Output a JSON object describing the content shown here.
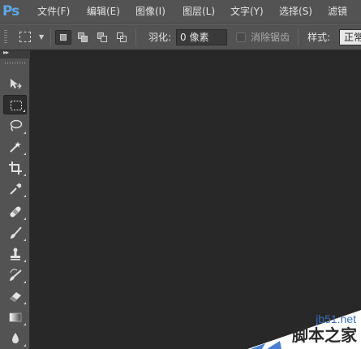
{
  "app": {
    "logo_text": "Ps"
  },
  "menu": [
    {
      "label": "文件(F)",
      "name": "menu-file"
    },
    {
      "label": "编辑(E)",
      "name": "menu-edit"
    },
    {
      "label": "图像(I)",
      "name": "menu-image"
    },
    {
      "label": "图层(L)",
      "name": "menu-layer"
    },
    {
      "label": "文字(Y)",
      "name": "menu-type"
    },
    {
      "label": "选择(S)",
      "name": "menu-select"
    },
    {
      "label": "滤镜",
      "name": "menu-filter"
    }
  ],
  "options": {
    "feather_label": "羽化:",
    "feather_value": "0 像素",
    "antialias_label": "消除锯齿",
    "antialias_checked": false,
    "style_label": "样式:",
    "style_value": "正常"
  },
  "tools": [
    {
      "name": "move-tool",
      "icon": "move-icon"
    },
    {
      "name": "rectangular-marquee-tool",
      "icon": "marquee-icon",
      "active": true
    },
    {
      "name": "lasso-tool",
      "icon": "lasso-icon"
    },
    {
      "name": "magic-wand-tool",
      "icon": "magic-wand-icon"
    },
    {
      "name": "crop-tool",
      "icon": "crop-icon"
    },
    {
      "name": "eyedropper-tool",
      "icon": "eyedropper-icon"
    },
    {
      "name": "healing-brush-tool",
      "icon": "bandage-icon"
    },
    {
      "name": "brush-tool",
      "icon": "brush-icon"
    },
    {
      "name": "clone-stamp-tool",
      "icon": "stamp-icon"
    },
    {
      "name": "history-brush-tool",
      "icon": "history-brush-icon"
    },
    {
      "name": "eraser-tool",
      "icon": "eraser-icon"
    },
    {
      "name": "gradient-tool",
      "icon": "gradient-icon"
    },
    {
      "name": "blur-tool",
      "icon": "droplet-icon"
    }
  ],
  "watermark": {
    "url": "jb51.net",
    "site_name": "脚本之家"
  },
  "colors": {
    "panel": "#535353",
    "canvas": "#282828",
    "logo": "#5fa8e8",
    "watermark_link": "#3d6fc0"
  }
}
